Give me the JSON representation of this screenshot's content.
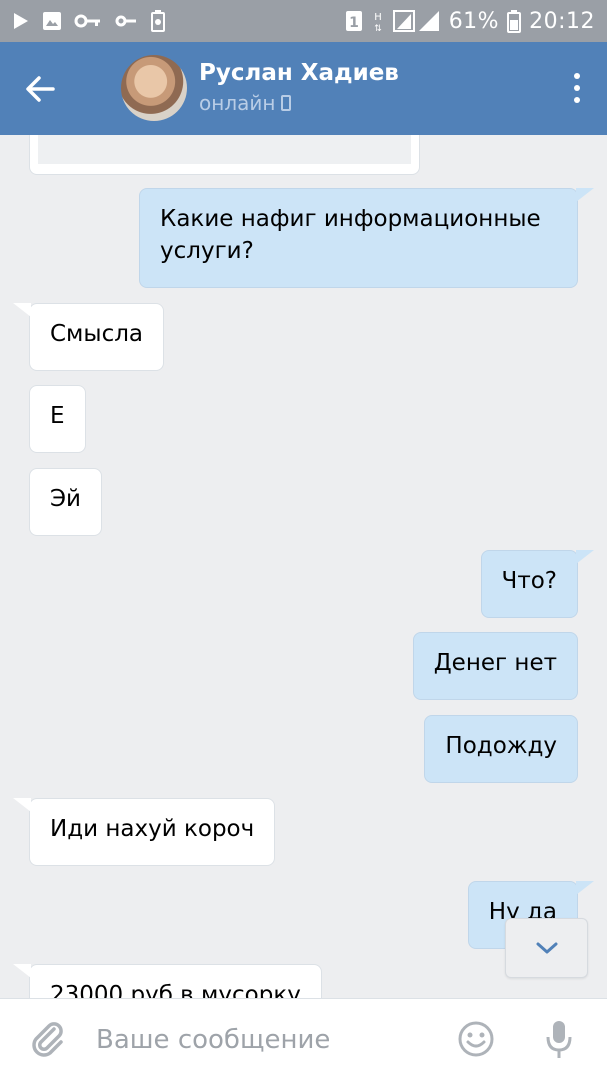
{
  "status_bar": {
    "icons": [
      "play-icon",
      "image-icon",
      "key-icon",
      "key-small-icon",
      "battery-saver-icon",
      "sim-1-icon",
      "signal-h-icon",
      "signal-bars-icon",
      "battery-icon"
    ],
    "battery": "61%",
    "time": "20:12"
  },
  "header": {
    "name": "Руслан Хадиев",
    "status": "онлайн"
  },
  "messages": [
    {
      "dir": "out",
      "text_line1": "Какие нафиг информационные",
      "text_line2": "услуги?"
    },
    {
      "dir": "in",
      "text": "Смысла"
    },
    {
      "dir": "in",
      "text": "Е"
    },
    {
      "dir": "in",
      "text": "Эй"
    },
    {
      "dir": "out",
      "text": "Что?"
    },
    {
      "dir": "out",
      "text": "Денег нет"
    },
    {
      "dir": "out",
      "text": "Подожду"
    },
    {
      "dir": "in",
      "text": "Иди нахуй короч"
    },
    {
      "dir": "out",
      "text": "Ну да"
    },
    {
      "dir": "in",
      "text": "23000 руб в мусорку"
    }
  ],
  "composer": {
    "placeholder": "Ваше сообщение"
  },
  "colors": {
    "header": "#5181b8",
    "background": "#edeef0",
    "outgoing": "#cce4f7",
    "incoming": "#ffffff"
  }
}
